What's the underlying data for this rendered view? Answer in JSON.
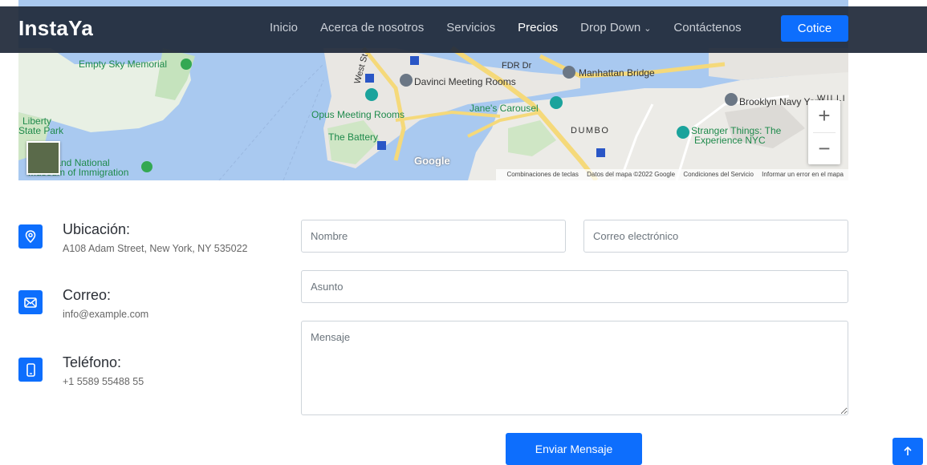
{
  "header": {
    "logo": "InstaYa",
    "nav": [
      {
        "label": "Inicio"
      },
      {
        "label": "Acerca de nosotros"
      },
      {
        "label": "Servicios"
      },
      {
        "label": "Precios"
      },
      {
        "label": "Drop Down"
      },
      {
        "label": "Contáctenos"
      }
    ],
    "cta_label": "Cotice"
  },
  "map": {
    "labels": {
      "empty_sky": "Empty Sky Memorial",
      "liberty": "Liberty",
      "state_park": "State Park",
      "ellis1": "s Island National",
      "ellis2": "Museum of Immigration",
      "opus": "Opus Meeting Rooms",
      "battery": "The Battery",
      "davinci": "Davinci Meeting Rooms",
      "carousel": "Jane's Carousel",
      "manhattan_bridge": "Manhattan Bridge",
      "dumbo": "DUMBO",
      "navy_yard": "Brooklyn Navy Yard",
      "stranger1": "Stranger Things: The",
      "stranger2": "Experience NYC",
      "williamsburg": "WILLI",
      "fdr": "FDR Dr",
      "west_st": "West St",
      "google": "Google"
    },
    "footer": {
      "shortcuts": "Combinaciones de teclas",
      "data": "Datos del mapa ©2022 Google",
      "terms": "Condiciones del Servicio",
      "report": "Informar un error en el mapa"
    },
    "zoom_in": "+",
    "zoom_out": "−"
  },
  "contact": {
    "location": {
      "title": "Ubicación:",
      "value": "A108 Adam Street, New York, NY 535022"
    },
    "email": {
      "title": "Correo:",
      "value": "info@example.com"
    },
    "phone": {
      "title": "Teléfono:",
      "value": "+1 5589 55488 55"
    }
  },
  "form": {
    "name_placeholder": "Nombre",
    "email_placeholder": "Correo electrónico",
    "subject_placeholder": "Asunto",
    "message_placeholder": "Mensaje",
    "submit_label": "Enviar Mensaje"
  },
  "colors": {
    "accent": "#0d6efd",
    "header_bg": "#1e2838"
  }
}
